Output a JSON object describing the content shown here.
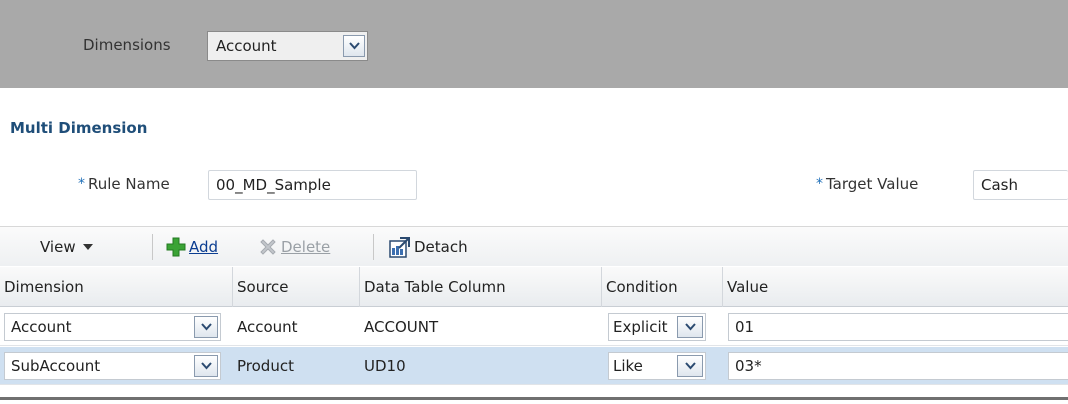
{
  "topbar": {
    "dimensions_label": "Dimensions",
    "dimension_value": "Account"
  },
  "section": {
    "title": "Multi Dimension"
  },
  "form": {
    "required_mark": "*",
    "rule_name_label": "Rule Name",
    "rule_name_value": "00_MD_Sample",
    "target_value_label": "Target Value",
    "target_value_value": "Cash"
  },
  "toolbar": {
    "view_label": "View",
    "add_label": "Add",
    "delete_label": "Delete",
    "detach_label": "Detach"
  },
  "table": {
    "headers": [
      "Dimension",
      "Source",
      "Data Table Column",
      "Condition",
      "Value"
    ],
    "rows": [
      {
        "dimension": "Account",
        "source": "Account",
        "column": "ACCOUNT",
        "condition": "Explicit",
        "value": "01"
      },
      {
        "dimension": "SubAccount",
        "source": "Product",
        "column": "UD10",
        "condition": "Like",
        "value": "03*"
      }
    ]
  },
  "colors": {
    "topbar_bg": "#a9a9a9",
    "section_title": "#1f4e79",
    "selected_row_bg": "#cfe0f1",
    "required_mark": "#1f6fb8",
    "add_icon": "#3aa335"
  }
}
